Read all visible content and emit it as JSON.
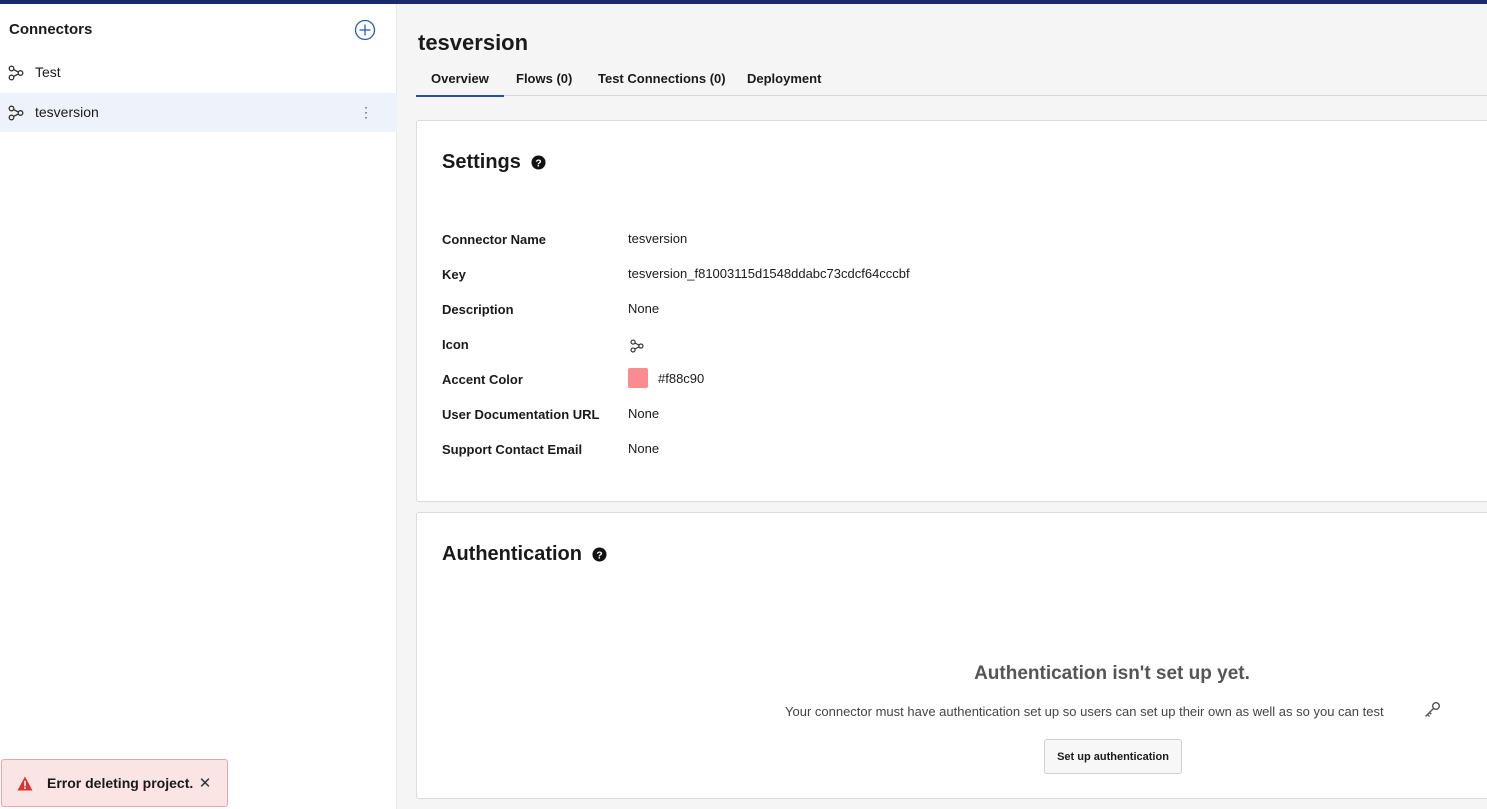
{
  "sidebar": {
    "header": "Connectors",
    "items": [
      {
        "label": "Test",
        "icon": "connector-icon",
        "active": false
      },
      {
        "label": "tesversion",
        "icon": "connector-icon",
        "active": true
      }
    ]
  },
  "main": {
    "title": "tesversion",
    "tabs": [
      {
        "label": "Overview",
        "active": true
      },
      {
        "label": "Flows (0)"
      },
      {
        "label": "Test Connections (0)"
      },
      {
        "label": "Deployment"
      }
    ]
  },
  "settings": {
    "title": "Settings",
    "fields": {
      "connector_name": {
        "label": "Connector Name",
        "value": "tesversion"
      },
      "key": {
        "label": "Key",
        "value": "tesversion_f81003115d1548ddabc73cdcf64cccbf"
      },
      "description": {
        "label": "Description",
        "value": "None"
      },
      "icon": {
        "label": "Icon",
        "value": "connector-icon"
      },
      "accent_color": {
        "label": "Accent Color",
        "value": "#f88c90"
      },
      "user_doc_url": {
        "label": "User Documentation URL",
        "value": "None"
      },
      "support_email": {
        "label": "Support Contact Email",
        "value": "None"
      }
    }
  },
  "authentication": {
    "title": "Authentication",
    "empty_title": "Authentication isn't set up yet.",
    "empty_desc": "Your connector must have authentication set up so users can set up their own as well as so you can test",
    "setup_button": "Set up authentication"
  },
  "toast": {
    "message": "Error deleting project.",
    "close": "✕"
  },
  "colors": {
    "topbar": "#1b2a6b",
    "tab_active": "#2b4ea2",
    "accent": "#f88c90",
    "error_bg": "#fbe4e4",
    "error_icon": "#d93434"
  }
}
